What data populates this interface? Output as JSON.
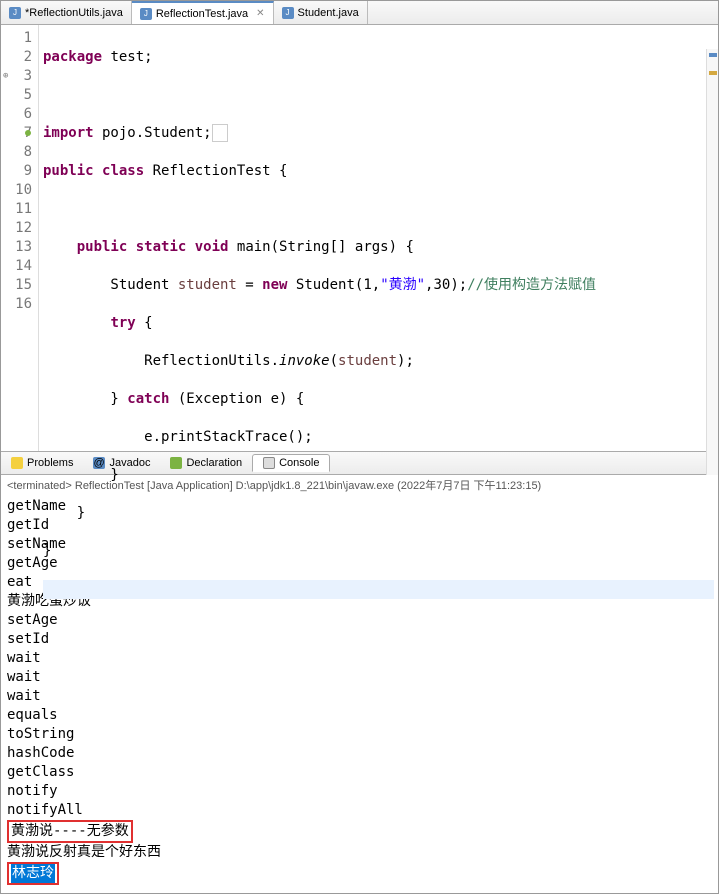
{
  "tabs": [
    {
      "label": "*ReflectionUtils.java"
    },
    {
      "label": "ReflectionTest.java"
    },
    {
      "label": "Student.java"
    }
  ],
  "gutter": [
    "1",
    "2",
    "3",
    "5",
    "6",
    "7",
    "8",
    "9",
    "10",
    "11",
    "12",
    "13",
    "14",
    "15",
    "16"
  ],
  "code": {
    "l1_kw": "package",
    "l1_rest": " test;",
    "l3_kw": "import",
    "l3_rest": " pojo.Student;",
    "l5a": "public",
    "l5b": "class",
    "l5_rest": " ReflectionTest {",
    "l7a": "public",
    "l7b": "static",
    "l7c": "void",
    "l7_rest": " main(String[] args) {",
    "l8a": "        Student ",
    "l8_var": "student",
    "l8b": " = ",
    "l8_kw": "new",
    "l8c": " Student(1,",
    "l8_str": "\"黄渤\"",
    "l8d": ",30);",
    "l8_cm": "//使用构造方法赋值",
    "l9_kw": "try",
    "l9_rest": " {",
    "l10a": "            ReflectionUtils.",
    "l10_m": "invoke",
    "l10b": "(",
    "l10_var": "student",
    "l10c": ");",
    "l11a": "        } ",
    "l11_kw": "catch",
    "l11b": " (Exception e) {",
    "l12": "            e.printStackTrace();",
    "l13": "        }",
    "l14": "    }",
    "l15": "}"
  },
  "btabs": {
    "problems": "Problems",
    "javadoc": "Javadoc",
    "declaration": "Declaration",
    "console": "Console"
  },
  "terminated": "<terminated> ReflectionTest [Java Application] D:\\app\\jdk1.8_221\\bin\\javaw.exe (2022年7月7日 下午11:23:15)",
  "out": [
    "getName",
    "getId",
    "setName",
    "getAge",
    "eat",
    "黄渤吃蛋炒饭",
    "setAge",
    "setId",
    "wait",
    "wait",
    "wait",
    "equals",
    "toString",
    "hashCode",
    "getClass",
    "notify",
    "notifyAll"
  ],
  "redline": "黄渤说----无参数",
  "line19": "黄渤说反射真是个好东西",
  "blue": "林志玲"
}
